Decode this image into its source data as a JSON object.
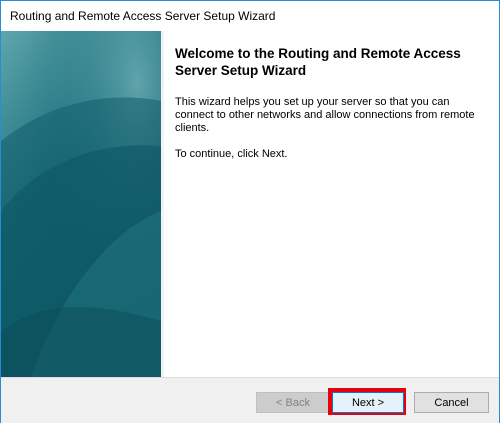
{
  "window": {
    "title": "Routing and Remote Access Server Setup Wizard"
  },
  "content": {
    "heading": "Welcome to the Routing and Remote Access Server Setup Wizard",
    "description": "This wizard helps you set up your server so that you can connect to other networks and allow connections from remote clients.",
    "instruction": "To continue, click Next."
  },
  "buttons": {
    "back_label": "< Back",
    "back_enabled": false,
    "next_label": "Next >",
    "next_highlighted": true,
    "cancel_label": "Cancel"
  },
  "colors": {
    "banner_teal_dark": "#0d5563",
    "banner_teal_light": "#3a8f98",
    "highlight_red": "#e8000b",
    "window_border": "#2b8cd6"
  }
}
